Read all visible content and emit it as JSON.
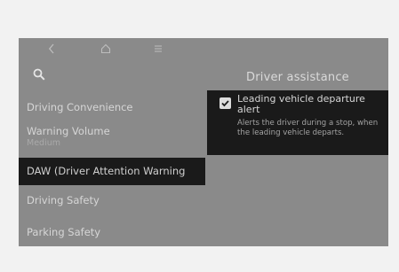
{
  "navigation": {
    "back_icon": "chevron-left-icon",
    "home_icon": "home-icon",
    "menu_icon": "menu-icon",
    "search_icon": "search-icon"
  },
  "header": {
    "title": "Driver assistance"
  },
  "sidebar": {
    "items": [
      {
        "label": "Driving Convenience",
        "value": ""
      },
      {
        "label": "Warning Volume",
        "value": "Medium"
      },
      {
        "label": "DAW (Driver Attention Warning",
        "value": ""
      },
      {
        "label": "Driving Safety",
        "value": ""
      },
      {
        "label": "Parking Safety",
        "value": ""
      }
    ]
  },
  "options": [
    {
      "label": "Leading vehicle departure alert",
      "description": "Alerts the driver during a stop, when the leading vehicle departs.",
      "checked": true
    }
  ],
  "colors": {
    "screen_background": "#8a8a8a",
    "selection_background": "#1a1a1a",
    "page_background": "#f2f2f2"
  }
}
